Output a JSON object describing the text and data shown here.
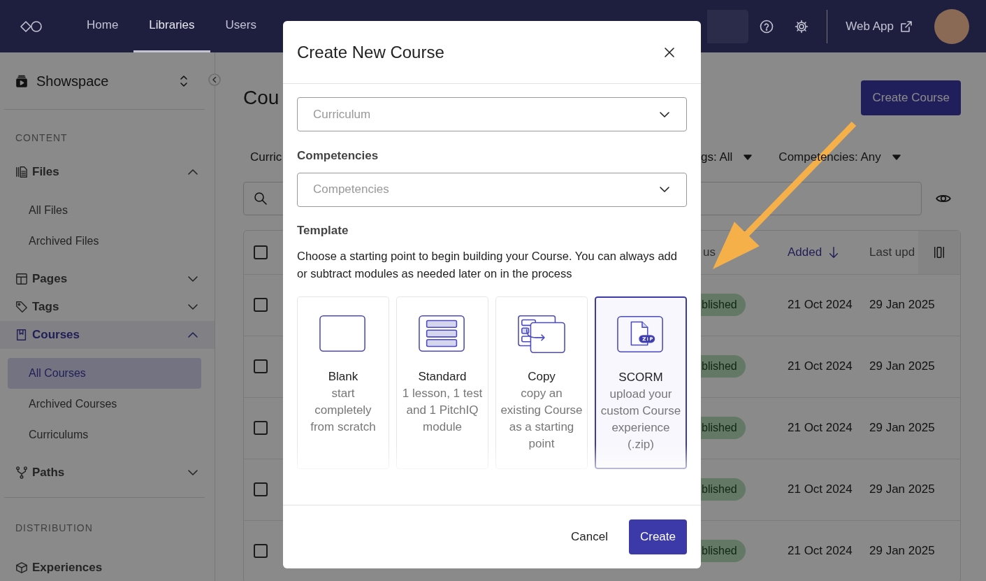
{
  "nav": {
    "tabs": [
      {
        "label": "Home",
        "selected": false
      },
      {
        "label": "Libraries",
        "selected": true
      },
      {
        "label": "Users",
        "selected": false
      }
    ],
    "web_app": "Web App"
  },
  "sidebar": {
    "workspace": "Showspace",
    "sections": [
      {
        "heading": "CONTENT",
        "items": [
          {
            "label": "Files",
            "expanded": true,
            "selected": false,
            "children": [
              {
                "label": "All Files",
                "selected": false
              },
              {
                "label": "Archived Files",
                "selected": false
              }
            ]
          },
          {
            "label": "Pages",
            "expanded": false,
            "selected": false
          },
          {
            "label": "Tags",
            "expanded": false,
            "selected": false
          },
          {
            "label": "Courses",
            "expanded": true,
            "selected": true,
            "children": [
              {
                "label": "All Courses",
                "selected": true
              },
              {
                "label": "Archived Courses",
                "selected": false
              },
              {
                "label": "Curriculums",
                "selected": false
              }
            ]
          },
          {
            "label": "Paths",
            "expanded": false,
            "selected": false
          }
        ]
      },
      {
        "heading": "DISTRIBUTION",
        "items": [
          {
            "label": "Experiences",
            "selected": false
          }
        ]
      }
    ]
  },
  "main": {
    "title": "Cou",
    "create_button": "Create Course",
    "filters": [
      {
        "label": "Curric",
        "caret": false
      },
      {
        "label": "gs: All",
        "caret": true
      },
      {
        "label": "Competencies: Any",
        "caret": true
      }
    ],
    "table": {
      "all_checked": false,
      "columns": [
        {
          "label": "us",
          "sorted": false
        },
        {
          "label": "Added",
          "sorted": true
        },
        {
          "label": "Last upd",
          "sorted": false
        }
      ],
      "rows": [
        {
          "checked": false,
          "status": "blished",
          "added": "21 Oct 2024",
          "updated": "29 Jan 2025"
        },
        {
          "checked": false,
          "status": "blished",
          "added": "21 Oct 2024",
          "updated": "29 Jan 2025"
        },
        {
          "checked": false,
          "status": "blished",
          "added": "21 Oct 2024",
          "updated": "29 Jan 2025"
        },
        {
          "checked": false,
          "status": "blished",
          "added": "21 Oct 2024",
          "updated": "29 Jan 2025"
        },
        {
          "checked": false,
          "status": "blished",
          "added": "21 Oct 2024",
          "updated": "29 Jan 2025"
        }
      ]
    }
  },
  "modal": {
    "title": "Create New Course",
    "fields": [
      {
        "placeholder": "Curriculum"
      },
      {
        "label": "Competencies",
        "placeholder": "Competencies"
      }
    ],
    "template": {
      "label": "Template",
      "description": "Choose a starting point to begin building your Course. You can always add or subtract modules as needed later on in the process",
      "options": [
        {
          "title": "Blank",
          "description": "start completely from scratch",
          "selected": false
        },
        {
          "title": "Standard",
          "description": "1 lesson, 1 test and 1 PitchIQ module",
          "selected": false
        },
        {
          "title": "Copy",
          "description": "copy an existing Course as a starting point",
          "selected": false
        },
        {
          "title": "SCORM",
          "description": "upload your custom Course experience (.zip)",
          "selected": true
        }
      ]
    },
    "cancel": "Cancel",
    "create": "Create"
  }
}
